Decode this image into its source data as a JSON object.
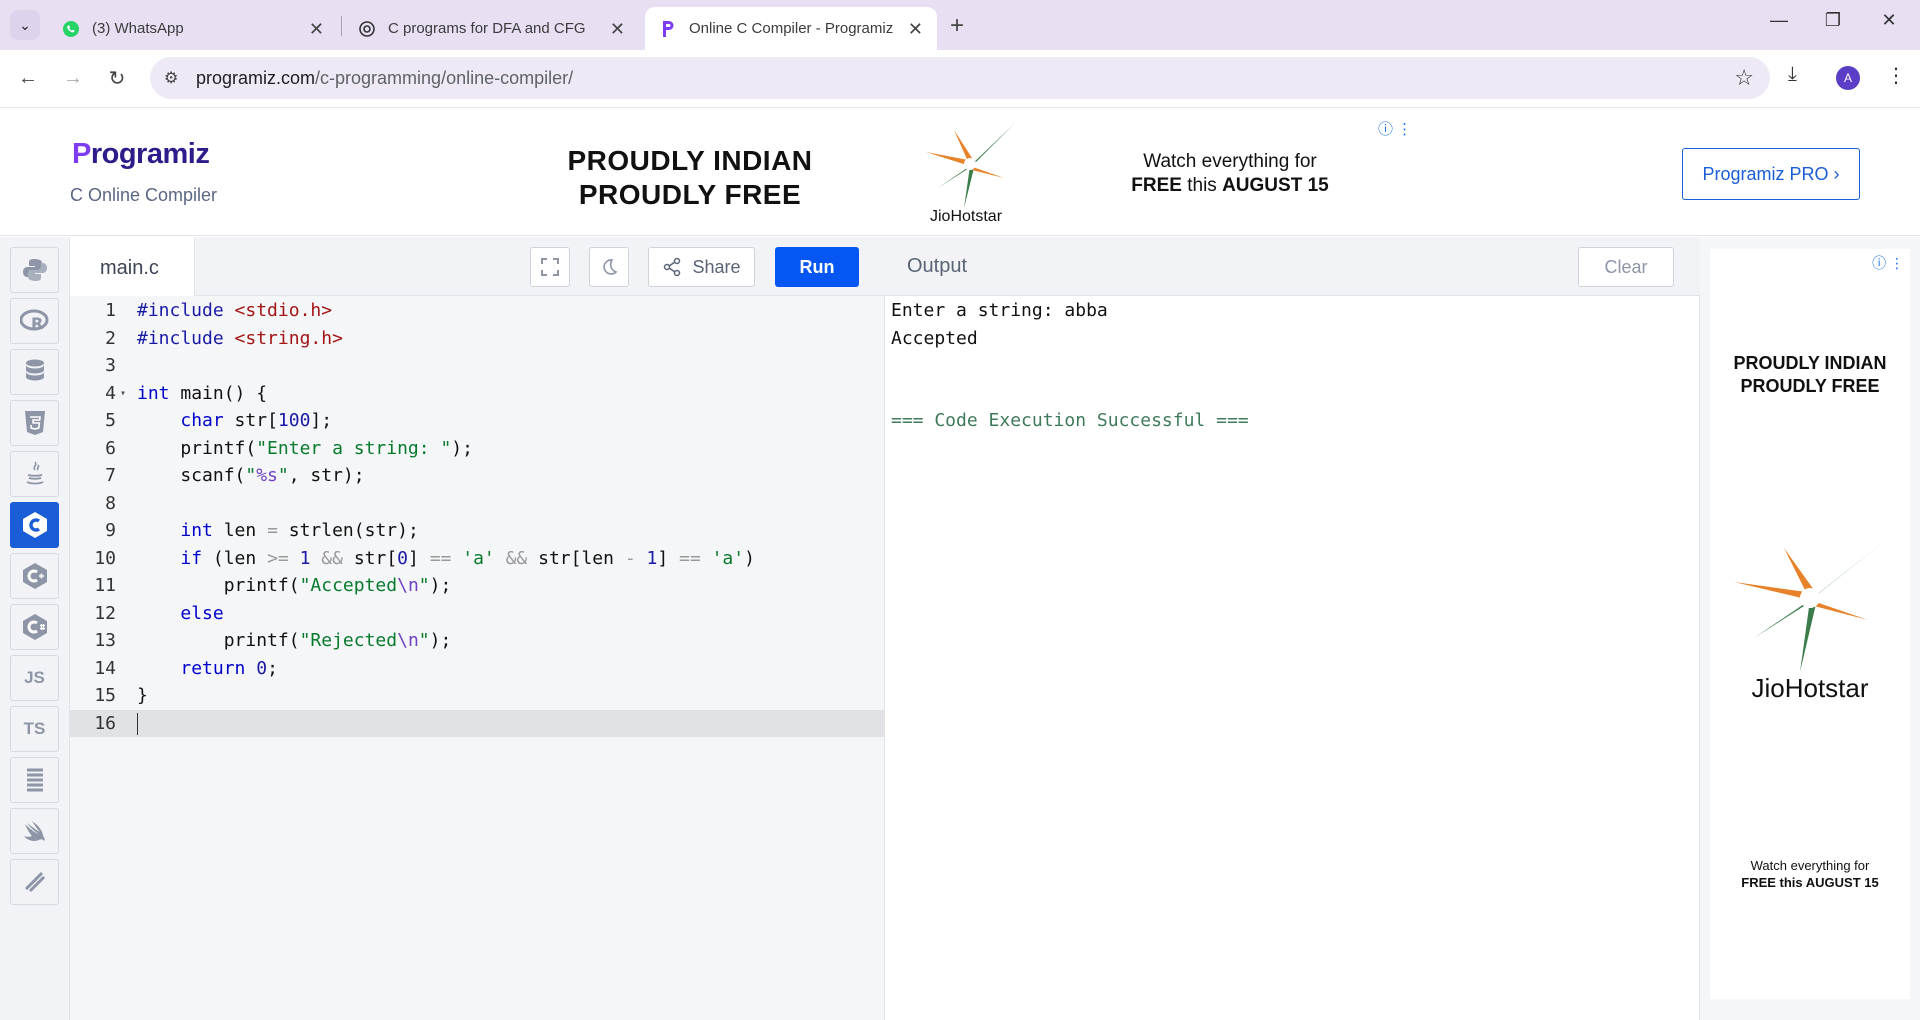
{
  "browser": {
    "tabs": [
      {
        "title": "(3) WhatsApp",
        "icon": "whatsapp-icon"
      },
      {
        "title": "C programs for DFA and CFG",
        "icon": "chatgpt-icon"
      },
      {
        "title": "Online C Compiler - Programiz",
        "icon": "programiz-icon",
        "active": true
      }
    ],
    "url_host": "programiz.com",
    "url_path": "/c-programming/online-compiler/",
    "avatar_letter": "A"
  },
  "site": {
    "logo_initial": "P",
    "logo_rest": "rogramiz",
    "subtitle": "C Online Compiler",
    "pro_button": "Programiz PRO ›"
  },
  "ad_banner": {
    "headline_1": "PROUDLY INDIAN",
    "headline_2": "PROUDLY FREE",
    "brand": "JioHotstar",
    "tagline_1": "Watch everything for",
    "tagline_2_bold": "FREE",
    "tagline_2_rest": " this ",
    "tagline_2_bold2": "AUGUST 15"
  },
  "sidebar": {
    "languages": [
      "python",
      "r",
      "sql",
      "html",
      "java",
      "c",
      "c++",
      "c#",
      "JS",
      "TS",
      "go",
      "swift",
      "rust"
    ],
    "active": "c"
  },
  "editor": {
    "filename": "main.c",
    "share_label": "Share",
    "run_label": "Run",
    "current_line": 16
  },
  "output": {
    "title": "Output",
    "clear_label": "Clear",
    "lines": [
      "Enter a string: abba",
      "Accepted",
      "",
      "",
      "=== Code Execution Successful ==="
    ]
  },
  "right_ad": {
    "headline_1": "PROUDLY INDIAN",
    "headline_2": "PROUDLY FREE",
    "brand": "JioHotstar",
    "tagline_1": "Watch everything for",
    "tagline_2": "FREE this AUGUST 15"
  },
  "colors": {
    "accent": "#0556f3",
    "logo_purple": "#7d3cf2",
    "tab_strip": "#e8dff2"
  }
}
